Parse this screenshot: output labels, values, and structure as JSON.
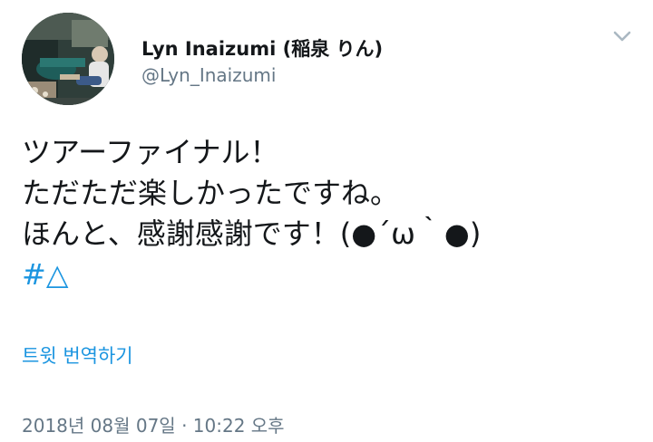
{
  "user": {
    "display_name": "Lyn Inaizumi (稲泉 りん)",
    "handle": "@Lyn_Inaizumi",
    "avatar_icon": "profile-photo"
  },
  "menu": {
    "icon": "chevron-down-icon"
  },
  "tweet": {
    "lines": [
      "ツアーファイナル！",
      "ただただ楽しかったですね。",
      "ほんと、感謝感謝です！(●´ω｀●)"
    ],
    "hashtag": "#△"
  },
  "translate_label": "트윗 번역하기",
  "timestamp": "2018년 08월 07일 · 10:22 오후",
  "colors": {
    "link": "#1b95e0",
    "secondary_text": "#657786",
    "primary_text": "#14171a"
  }
}
